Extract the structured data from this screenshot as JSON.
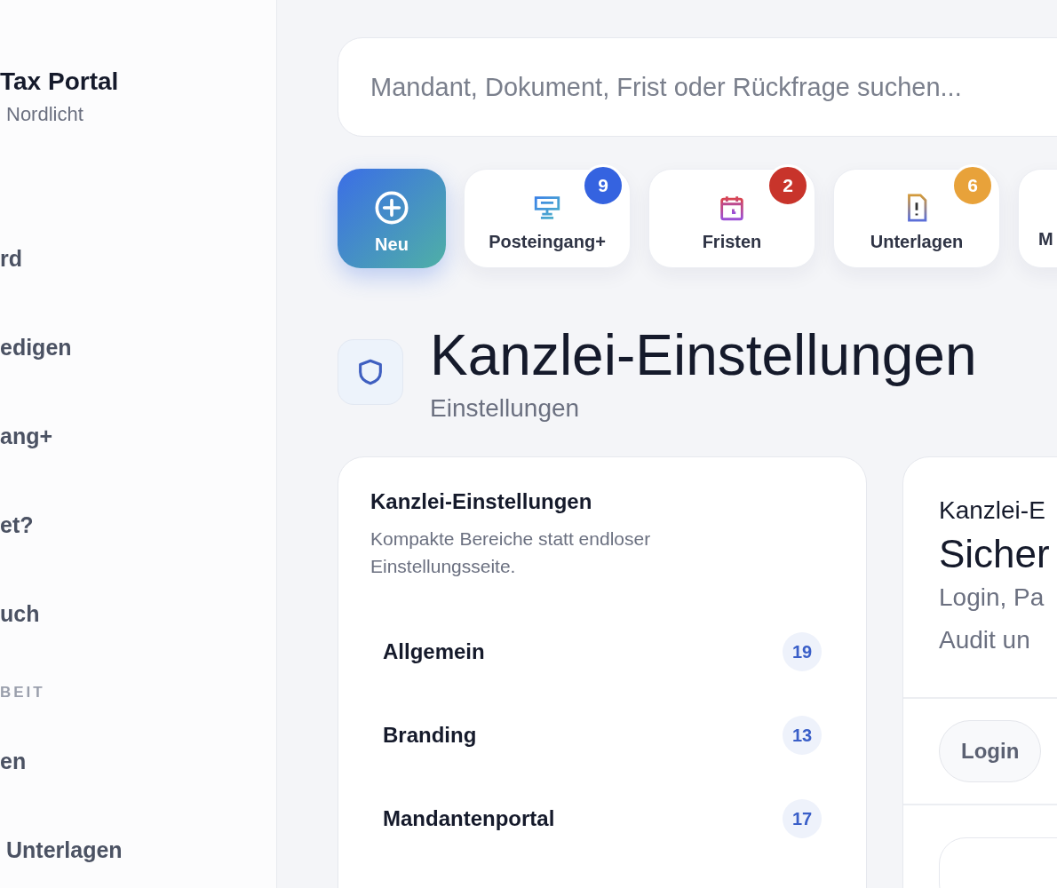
{
  "sidebar": {
    "brand": {
      "title": "Tax Portal",
      "subtitle": "Nordlicht"
    },
    "items": [
      {
        "kind": "item",
        "label": "rd"
      },
      {
        "kind": "item",
        "label": "edigen"
      },
      {
        "kind": "item",
        "label": "ang+"
      },
      {
        "kind": "item",
        "label": "et?"
      },
      {
        "kind": "item",
        "label": "uch"
      },
      {
        "kind": "section",
        "label": "BEIT"
      },
      {
        "kind": "item",
        "label": "en"
      },
      {
        "kind": "item",
        "label": "Unterlagen"
      }
    ]
  },
  "search": {
    "placeholder": "Mandant, Dokument, Frist oder Rückfrage suchen..."
  },
  "quick_actions": [
    {
      "kind": "new",
      "label": "Neu"
    },
    {
      "kind": "inbox",
      "label": "Posteingang+",
      "badge": "9",
      "color": "#3563e0"
    },
    {
      "kind": "deadline",
      "label": "Fristen",
      "badge": "2",
      "color": "#c8342b"
    },
    {
      "kind": "document",
      "label": "Unterlagen",
      "badge": "6",
      "color": "#e8a23a"
    },
    {
      "kind": "other",
      "label": "M"
    }
  ],
  "page": {
    "title": "Kanzlei-Einstellungen",
    "subtitle": "Einstellungen"
  },
  "sections_card": {
    "title": "Kanzlei-Einstellungen",
    "description": "Kompakte Bereiche statt endloser Einstellungsseite.",
    "items": [
      {
        "label": "Allgemein",
        "count": "19"
      },
      {
        "label": "Branding",
        "count": "13"
      },
      {
        "label": "Mandantenportal",
        "count": "17"
      }
    ]
  },
  "detail_card": {
    "eyebrow": "Kanzlei-E",
    "title": "Sicher",
    "description_lines": [
      "Login, Pa",
      "Audit un"
    ],
    "chips": [
      "Login"
    ]
  }
}
